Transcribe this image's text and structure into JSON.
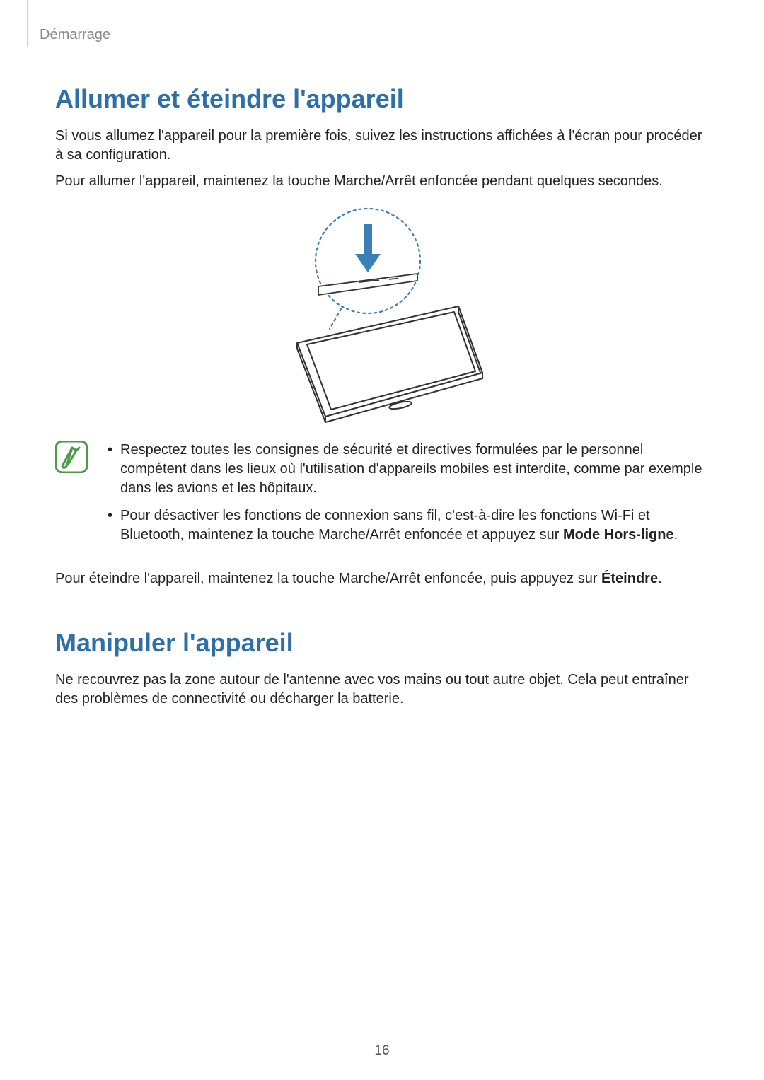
{
  "breadcrumb": "Démarrage",
  "section1": {
    "heading": "Allumer et éteindre l'appareil",
    "para1": "Si vous allumez l'appareil pour la première fois, suivez les instructions affichées à l'écran pour procéder à sa configuration.",
    "para2": "Pour allumer l'appareil, maintenez la touche Marche/Arrêt enfoncée pendant quelques secondes.",
    "bullet1": "Respectez toutes les consignes de sécurité et directives formulées par le personnel compétent dans les lieux où l'utilisation d'appareils mobiles est interdite, comme par exemple dans les avions et les hôpitaux.",
    "bullet2_prefix": "Pour désactiver les fonctions de connexion sans fil, c'est-à-dire les fonctions Wi-Fi et Bluetooth, maintenez la touche Marche/Arrêt enfoncée et appuyez sur ",
    "bullet2_bold": "Mode Hors-ligne",
    "bullet2_suffix": ".",
    "para3_prefix": "Pour éteindre l'appareil, maintenez la touche Marche/Arrêt enfoncée, puis appuyez sur ",
    "para3_bold": "Éteindre",
    "para3_suffix": "."
  },
  "section2": {
    "heading": "Manipuler l'appareil",
    "para1": "Ne recouvrez pas la zone autour de l'antenne avec vos mains ou tout autre objet. Cela peut entraîner des problèmes de connectivité ou décharger la batterie."
  },
  "page_number": "16"
}
